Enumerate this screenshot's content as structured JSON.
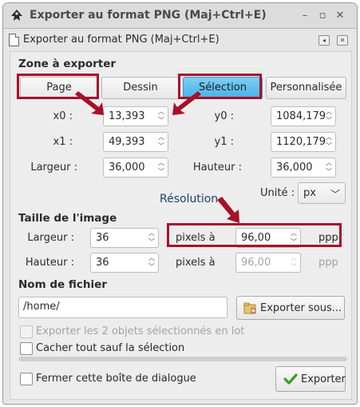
{
  "window": {
    "title": "Exporter au format PNG (Maj+Ctrl+E)",
    "icon": "inkscape-logo-icon",
    "controls": [
      "minimize-icon",
      "maximize-icon",
      "close-icon"
    ]
  },
  "panel": {
    "title": "Exporter au format PNG (Maj+Ctrl+E)",
    "icon": "document-icon",
    "buttons": [
      "dock-icon",
      "close-panel-icon"
    ]
  },
  "export_area": {
    "heading": "Zone à exporter",
    "tabs": [
      {
        "label": "Page",
        "active": false
      },
      {
        "label": "Dessin",
        "active": false
      },
      {
        "label": "Sélection",
        "active": true
      },
      {
        "label": "Personnalisée",
        "active": false
      }
    ],
    "x0_label": "x0 :",
    "x0": "13,393",
    "x1_label": "x1 :",
    "x1": "49,393",
    "y0_label": "y0 :",
    "y0": "1084,179",
    "y1_label": "y1 :",
    "y1": "1120,179",
    "width_label": "Largeur :",
    "width": "36,000",
    "height_label": "Hauteur :",
    "height": "36,000",
    "unit_label": "Unité :",
    "unit": "px"
  },
  "image_size": {
    "heading": "Taille de l'image",
    "width_label": "Largeur :",
    "width": "36",
    "height_label": "Hauteur :",
    "height": "36",
    "dpi_label": "pixels à",
    "dpi": "96,00",
    "dpi_unit": "ppp",
    "dpi2_label": "pixels à",
    "dpi2": "96,00",
    "dpi2_unit": "ppp"
  },
  "filename": {
    "heading": "Nom de fichier",
    "value": "/home/",
    "export_as_label": "Exporter sous..."
  },
  "options": {
    "batch_label": "Exporter les 2 objets sélectionnés en lot",
    "hide_label": "Cacher tout sauf la sélection"
  },
  "footer": {
    "close_label": "Fermer cette boîte de dialogue",
    "export_label": "Exporter"
  },
  "annotation": {
    "resolution_label": "Résolution",
    "color": "#a8102a"
  },
  "colors": {
    "accent": "#47b1e6",
    "highlight": "#a8102a",
    "annotation_text": "#1f3f6e"
  }
}
